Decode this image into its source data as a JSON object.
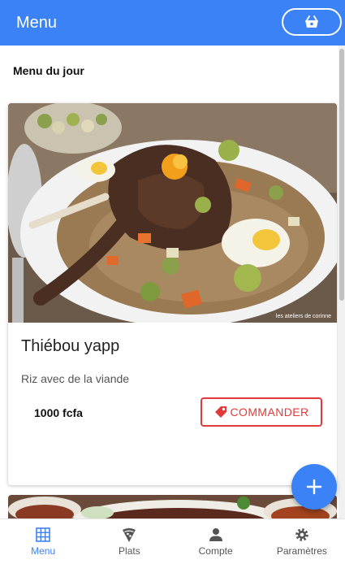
{
  "app": {
    "title": "Menu"
  },
  "section": {
    "title": "Menu du jour"
  },
  "dish": {
    "name": "Thiébou yapp",
    "description": "Riz avec de la viande",
    "price": "1000 fcfa",
    "order_label": "COMMANDER",
    "photo_credit": "les ateliers de corinne"
  },
  "nav": [
    {
      "label": "Menu",
      "icon": "grid-icon",
      "active": true
    },
    {
      "label": "Plats",
      "icon": "pizza-icon",
      "active": false
    },
    {
      "label": "Compte",
      "icon": "person-icon",
      "active": false
    },
    {
      "label": "Paramètres",
      "icon": "gear-icon",
      "active": false
    }
  ],
  "colors": {
    "primary": "#3b82f6",
    "accent": "#e23a3a"
  }
}
